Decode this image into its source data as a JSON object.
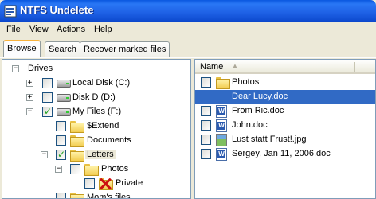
{
  "window": {
    "title": "NTFS Undelete"
  },
  "menu": [
    "File",
    "View",
    "Actions",
    "Help"
  ],
  "tabs": [
    "Browse",
    "Search",
    "Recover marked files"
  ],
  "tree": {
    "root": "Drives",
    "items": [
      {
        "label": "Local Disk (C:)"
      },
      {
        "label": "Disk D (D:)"
      },
      {
        "label": "My Files (F:)"
      },
      {
        "label": "$Extend"
      },
      {
        "label": "Documents"
      },
      {
        "label": "Letters"
      },
      {
        "label": "Photos"
      },
      {
        "label": "Private"
      },
      {
        "label": "Mom's files"
      }
    ]
  },
  "list": {
    "column": "Name",
    "items": [
      {
        "label": "Photos"
      },
      {
        "label": "Dear Lucy.doc"
      },
      {
        "label": "From Ric.doc"
      },
      {
        "label": "John.doc"
      },
      {
        "label": "Lust statt Frust!.jpg"
      },
      {
        "label": "Sergey, Jan 11, 2006.doc"
      }
    ]
  }
}
